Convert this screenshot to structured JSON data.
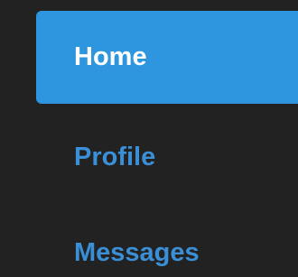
{
  "nav": {
    "items": [
      {
        "label": "Home",
        "active": true
      },
      {
        "label": "Profile",
        "active": false
      },
      {
        "label": "Messages",
        "active": false
      }
    ]
  },
  "colors": {
    "background": "#222222",
    "active_bg": "#2d96df",
    "active_text": "#ffffff",
    "link_text": "#3a8fd6"
  }
}
